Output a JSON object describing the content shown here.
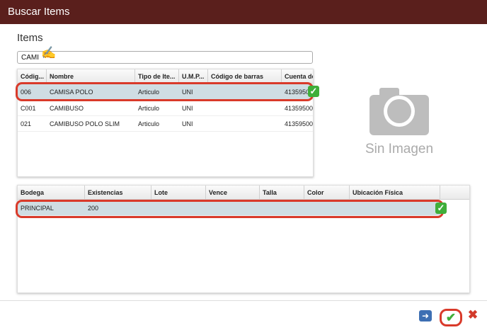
{
  "window": {
    "title": "Buscar Items"
  },
  "items_section": {
    "title": "Items"
  },
  "search": {
    "value": "CAMI"
  },
  "items_table": {
    "columns": [
      "Códig...",
      "Nombre",
      "Tipo de Ite...",
      "U.M.P...",
      "Código de barras",
      "Cuenta de"
    ],
    "rows": [
      {
        "codigo": "006",
        "nombre": "CAMISA POLO",
        "tipo": "Articulo",
        "ump": "UNI",
        "barras": "",
        "cuenta": "41359500"
      },
      {
        "codigo": "C001",
        "nombre": "CAMIBUSO",
        "tipo": "Articulo",
        "ump": "UNI",
        "barras": "",
        "cuenta": "41359500"
      },
      {
        "codigo": "021",
        "nombre": "CAMIBUSO POLO SLIM",
        "tipo": "Articulo",
        "ump": "UNI",
        "barras": "",
        "cuenta": "41359500"
      }
    ]
  },
  "image_panel": {
    "label": "Sin Imagen"
  },
  "stock_table": {
    "columns": [
      "Bodega",
      "Existencias",
      "Lote",
      "Vence",
      "Talla",
      "Color",
      "Ubicación Física"
    ],
    "rows": [
      {
        "bodega": "PRINCIPAL",
        "existencias": "200",
        "lote": "",
        "vence": "",
        "talla": "",
        "color": "",
        "ubicacion": ""
      }
    ]
  },
  "actions": {
    "next_icon": "arrow-right-icon",
    "confirm_icon": "checkmark-icon",
    "close_icon": "x-icon"
  }
}
